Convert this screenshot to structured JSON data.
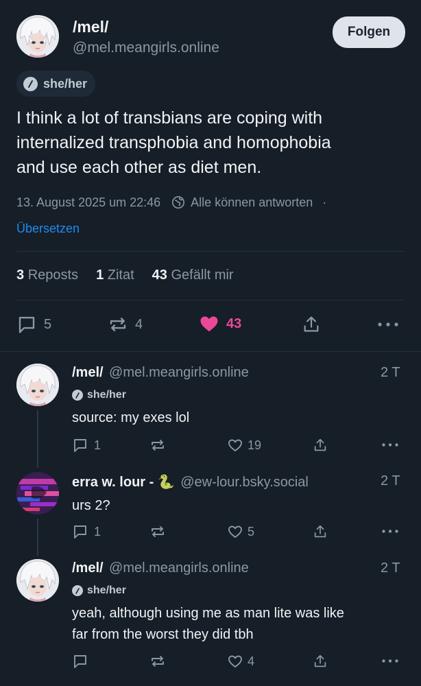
{
  "main_post": {
    "author": {
      "display_name": "/mel/",
      "handle": "@mel.meangirls.online",
      "pronouns": "she/her"
    },
    "follow_label": "Folgen",
    "text_lines": [
      "I think a lot of transbians are coping with",
      "internalized transphobia and homophobia",
      "and use each other as diet men."
    ],
    "timestamp": "13. August 2025 um 22:46",
    "reply_setting": "Alle können antworten",
    "separator": "·",
    "translate_label": "Übersetzen",
    "stats": {
      "reposts_count": "3",
      "reposts_label": "Reposts",
      "quotes_count": "1",
      "quotes_label": "Zitat",
      "likes_count": "43",
      "likes_label": "Gefällt mir"
    },
    "actions": {
      "replies": "5",
      "reposts": "4",
      "likes": "43"
    }
  },
  "replies": [
    {
      "display_name": "/mel/",
      "handle": "@mel.meangirls.online",
      "time": "2 T",
      "pronouns": "she/her",
      "text": "source: my exes lol",
      "counts": {
        "replies": "1",
        "reposts": "",
        "likes": "19"
      }
    },
    {
      "display_name": "erra w. lour - 🐍",
      "handle": "@ew-lour.bsky.social",
      "time": "2 T",
      "text": "urs 2?",
      "counts": {
        "replies": "1",
        "reposts": "",
        "likes": "5"
      }
    },
    {
      "display_name": "/mel/",
      "handle": "@mel.meangirls.online",
      "time": "2 T",
      "pronouns": "she/her",
      "text_lines": [
        "yeah, although using me as man lite was like",
        "far from the worst they did tbh"
      ],
      "counts": {
        "replies": "",
        "reposts": "",
        "likes": "4"
      }
    }
  ],
  "colors": {
    "background": "#161e27",
    "accent_link": "#1e8cf0",
    "like_pink": "#ec4899",
    "muted_text": "#8b98a5"
  },
  "icons": [
    "reply-icon",
    "repost-icon",
    "heart-icon",
    "share-icon",
    "more-icon",
    "pronoun-icon",
    "globe-icon"
  ]
}
